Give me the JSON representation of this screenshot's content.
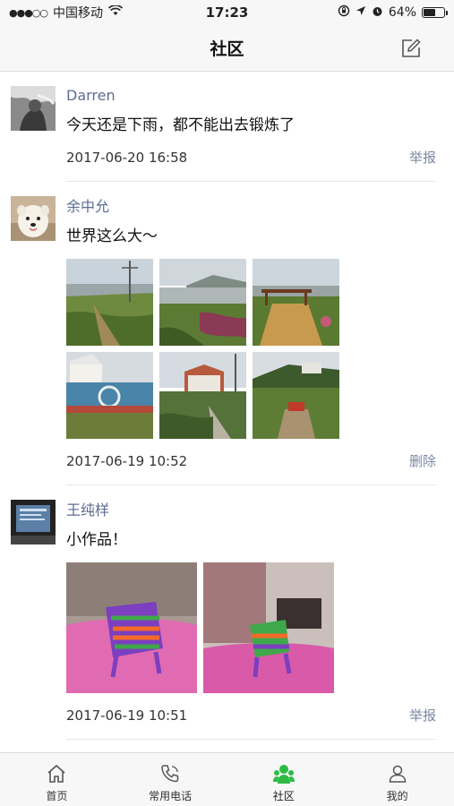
{
  "status_bar": {
    "signal": "●●●○○",
    "carrier": "中国移动",
    "time": "17:23",
    "battery": "64%",
    "battery_level": 0.64
  },
  "nav": {
    "title": "社区"
  },
  "posts": [
    {
      "author": "Darren",
      "text": "今天还是下雨，都不能出去锻炼了",
      "time": "2017-06-20 16:58",
      "action": "举报"
    },
    {
      "author": "余中允",
      "text": "世界这么大～",
      "time": "2017-06-19 10:52",
      "action": "删除"
    },
    {
      "author": "王纯样",
      "text": "小作品！",
      "time": "2017-06-19 10:51",
      "action": "举报"
    }
  ],
  "tabs": [
    {
      "label": "首页",
      "icon": "home-icon"
    },
    {
      "label": "常用电话",
      "icon": "phone-icon"
    },
    {
      "label": "社区",
      "icon": "community-icon"
    },
    {
      "label": "我的",
      "icon": "user-icon"
    }
  ],
  "colors": {
    "accent_green": "#2dbb45",
    "name_blue": "#5d6d93"
  }
}
